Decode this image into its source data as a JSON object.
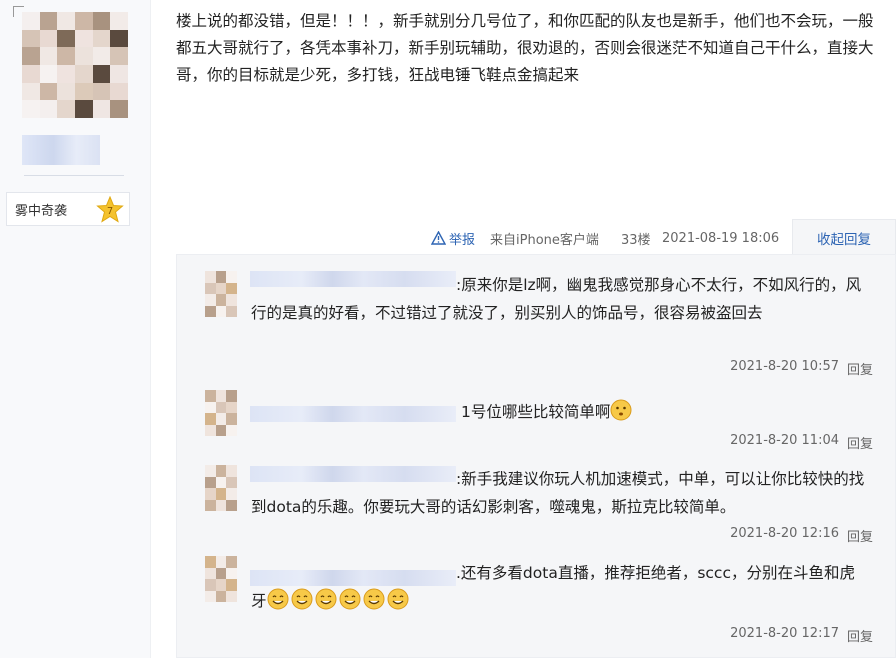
{
  "user": {
    "level_badge_text": "雾中奇袭",
    "level_number": "7"
  },
  "post": {
    "content": "楼上说的都没错，但是！！！，新手就别分几号位了，和你匹配的队友也是新手，他们也不会玩，一般都五大哥就行了，各凭本事补刀，新手别玩辅助，很劝退的，否则会很迷茫不知道自己干什么，直接大哥，你的目标就是少死，多打钱，狂战电锤飞鞋点金搞起来",
    "report_label": "举报",
    "source": "来自iPhone客户端",
    "floor": "33楼",
    "datetime": "2021-08-19 18:06",
    "collapse_label": "收起回复"
  },
  "replies": [
    {
      "text": ":原来你是lz啊，幽鬼我感觉那身心不太行，不如风行的，风行的是真的好看，不过错过了就没了，别买别人的饰品号，很容易被盗回去",
      "time": "2021-8-20 10:57",
      "reply_label": "回复"
    },
    {
      "text": "1号位哪些比较简单啊",
      "time": "2021-8-20 11:04",
      "reply_label": "回复"
    },
    {
      "text": ":新手我建议你玩人机加速模式，中单，可以让你比较快的找到dota的乐趣。你要玩大哥的话幻影刺客，噬魂鬼，斯拉克比较简单。",
      "time": "2021-8-20 12:16",
      "reply_label": "回复"
    },
    {
      "text": ".还有多看dota直播，推荐拒绝者，sccc，分别在斗鱼和虎牙",
      "time": "2021-8-20 12:17",
      "reply_label": "回复"
    }
  ],
  "colors": {
    "link": "#2d64b3",
    "meta": "#666666",
    "reply_bg": "#f5f6f8"
  }
}
